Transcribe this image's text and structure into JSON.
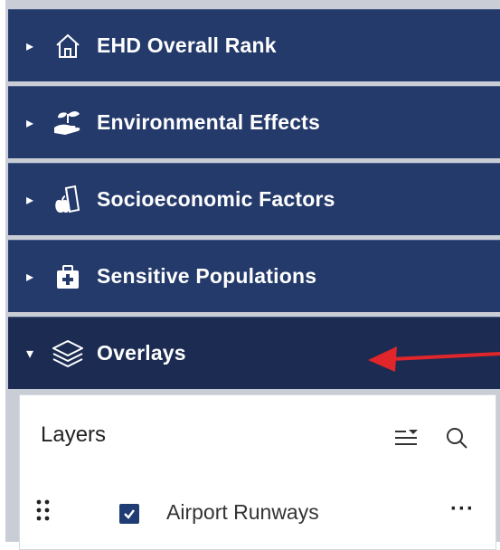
{
  "panels": [
    {
      "label": "EHD Overall Rank",
      "caret": "▸",
      "icon": "home-icon"
    },
    {
      "label": "Environmental Effects",
      "caret": "▸",
      "icon": "plant-hand-icon"
    },
    {
      "label": "Socioeconomic Factors",
      "caret": "▸",
      "icon": "apple-book-icon"
    },
    {
      "label": "Sensitive Populations",
      "caret": "▸",
      "icon": "medkit-icon"
    },
    {
      "label": "Overlays",
      "caret": "▾",
      "icon": "layers-icon"
    }
  ],
  "layers_panel": {
    "title": "Layers",
    "tools": [
      "filter-sort-icon",
      "search-icon"
    ],
    "items": [
      {
        "name": "Airport Runways",
        "checked": true,
        "more": "···"
      }
    ]
  },
  "colors": {
    "panel": "#243a6b",
    "panel_active": "#1b2b52",
    "checkbox": "#1f3c73",
    "annotation_arrow": "#e0262a"
  }
}
